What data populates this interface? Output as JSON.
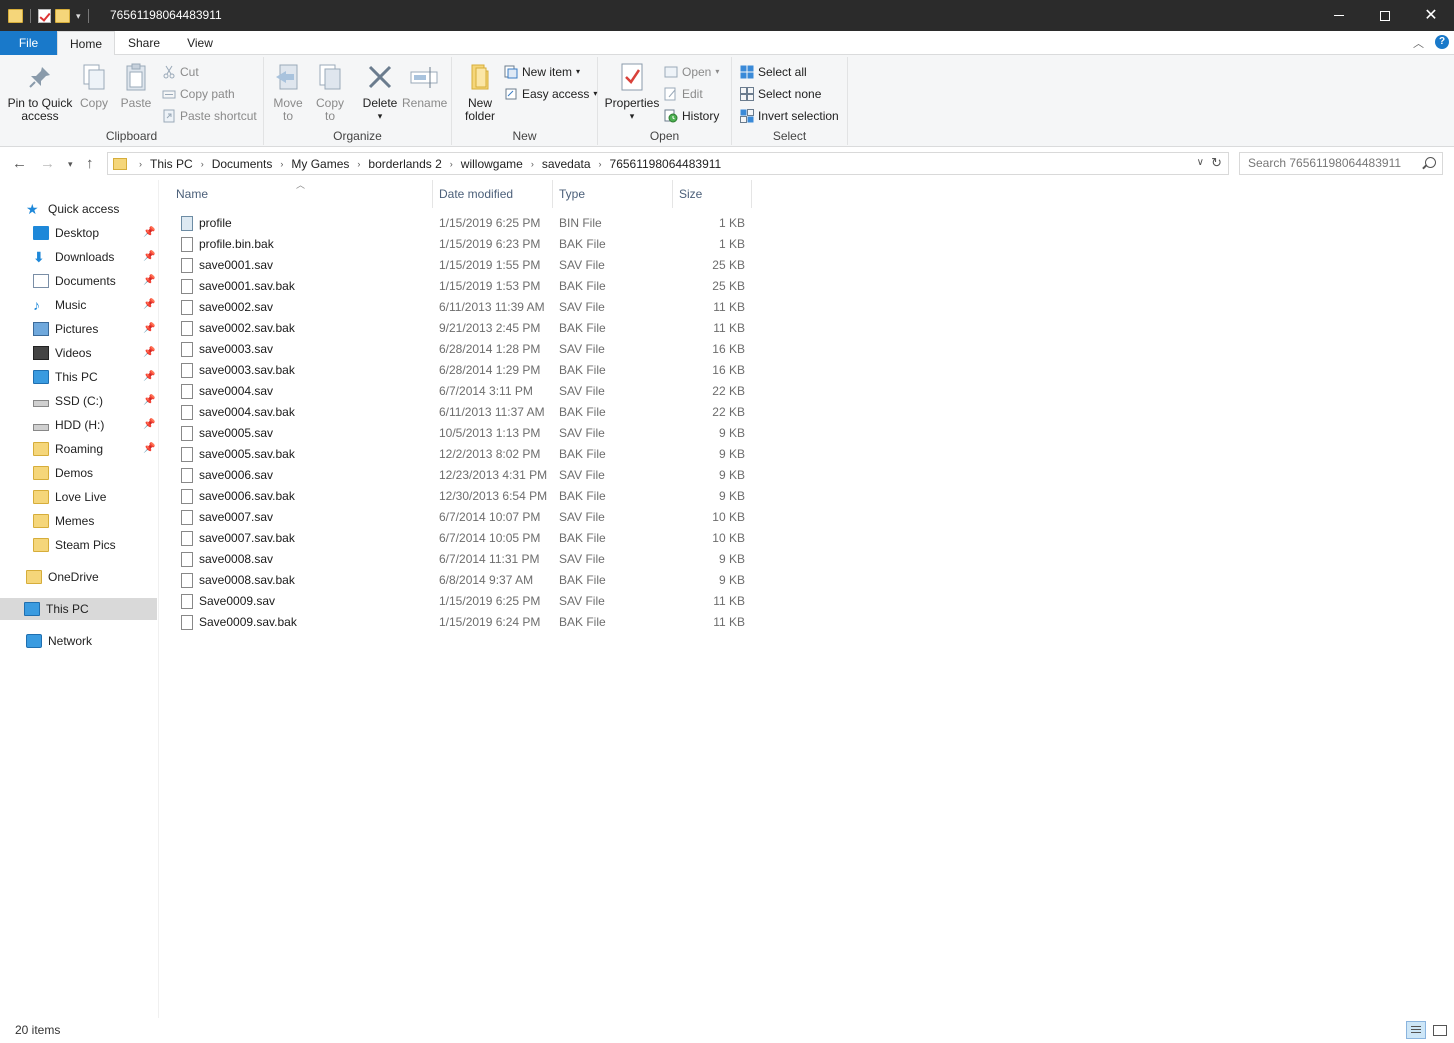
{
  "window": {
    "title": "76561198064483911"
  },
  "ribbon_tabs": [
    "File",
    "Home",
    "Share",
    "View"
  ],
  "ribbon": {
    "clipboard": {
      "label": "Clipboard",
      "pin_line1": "Pin to Quick",
      "pin_line2": "access",
      "copy": "Copy",
      "paste": "Paste",
      "cut": "Cut",
      "copy_path": "Copy path",
      "paste_shortcut": "Paste shortcut"
    },
    "organize": {
      "label": "Organize",
      "move_line1": "Move",
      "move_line2": "to",
      "copy_line1": "Copy",
      "copy_line2": "to",
      "delete": "Delete",
      "rename": "Rename"
    },
    "new": {
      "label": "New",
      "new_folder_line1": "New",
      "new_folder_line2": "folder",
      "new_item": "New item",
      "easy_access": "Easy access"
    },
    "open": {
      "label": "Open",
      "properties": "Properties",
      "open": "Open",
      "edit": "Edit",
      "history": "History"
    },
    "select": {
      "label": "Select",
      "select_all": "Select all",
      "select_none": "Select none",
      "invert_selection": "Invert selection"
    }
  },
  "address": {
    "crumbs": [
      "This PC",
      "Documents",
      "My Games",
      "borderlands 2",
      "willowgame",
      "savedata",
      "76561198064483911"
    ],
    "search_placeholder": "Search 76561198064483911"
  },
  "nav": {
    "quick_access": "Quick access",
    "pinned": [
      "Desktop",
      "Downloads",
      "Documents",
      "Music",
      "Pictures",
      "Videos",
      "This PC",
      "SSD (C:)",
      "HDD (H:)",
      "Roaming"
    ],
    "folders": [
      "Demos",
      "Love Live",
      "Memes",
      "Steam Pics"
    ],
    "onedrive": "OneDrive",
    "this_pc": "This PC",
    "network": "Network"
  },
  "columns": {
    "name": "Name",
    "date": "Date modified",
    "type": "Type",
    "size": "Size"
  },
  "files": [
    {
      "name": "profile",
      "date": "1/15/2019 6:25 PM",
      "type": "BIN File",
      "size": "1 KB"
    },
    {
      "name": "profile.bin.bak",
      "date": "1/15/2019 6:23 PM",
      "type": "BAK File",
      "size": "1 KB"
    },
    {
      "name": "save0001.sav",
      "date": "1/15/2019 1:55 PM",
      "type": "SAV File",
      "size": "25 KB"
    },
    {
      "name": "save0001.sav.bak",
      "date": "1/15/2019 1:53 PM",
      "type": "BAK File",
      "size": "25 KB"
    },
    {
      "name": "save0002.sav",
      "date": "6/11/2013 11:39 AM",
      "type": "SAV File",
      "size": "11 KB"
    },
    {
      "name": "save0002.sav.bak",
      "date": "9/21/2013 2:45 PM",
      "type": "BAK File",
      "size": "11 KB"
    },
    {
      "name": "save0003.sav",
      "date": "6/28/2014 1:28 PM",
      "type": "SAV File",
      "size": "16 KB"
    },
    {
      "name": "save0003.sav.bak",
      "date": "6/28/2014 1:29 PM",
      "type": "BAK File",
      "size": "16 KB"
    },
    {
      "name": "save0004.sav",
      "date": "6/7/2014 3:11 PM",
      "type": "SAV File",
      "size": "22 KB"
    },
    {
      "name": "save0004.sav.bak",
      "date": "6/11/2013 11:37 AM",
      "type": "BAK File",
      "size": "22 KB"
    },
    {
      "name": "save0005.sav",
      "date": "10/5/2013 1:13 PM",
      "type": "SAV File",
      "size": "9 KB"
    },
    {
      "name": "save0005.sav.bak",
      "date": "12/2/2013 8:02 PM",
      "type": "BAK File",
      "size": "9 KB"
    },
    {
      "name": "save0006.sav",
      "date": "12/23/2013 4:31 PM",
      "type": "SAV File",
      "size": "9 KB"
    },
    {
      "name": "save0006.sav.bak",
      "date": "12/30/2013 6:54 PM",
      "type": "BAK File",
      "size": "9 KB"
    },
    {
      "name": "save0007.sav",
      "date": "6/7/2014 10:07 PM",
      "type": "SAV File",
      "size": "10 KB"
    },
    {
      "name": "save0007.sav.bak",
      "date": "6/7/2014 10:05 PM",
      "type": "BAK File",
      "size": "10 KB"
    },
    {
      "name": "save0008.sav",
      "date": "6/7/2014 11:31 PM",
      "type": "SAV File",
      "size": "9 KB"
    },
    {
      "name": "save0008.sav.bak",
      "date": "6/8/2014 9:37 AM",
      "type": "BAK File",
      "size": "9 KB"
    },
    {
      "name": "Save0009.sav",
      "date": "1/15/2019 6:25 PM",
      "type": "SAV File",
      "size": "11 KB"
    },
    {
      "name": "Save0009.sav.bak",
      "date": "1/15/2019 6:24 PM",
      "type": "BAK File",
      "size": "11 KB"
    }
  ],
  "status": {
    "item_count": "20 items"
  },
  "colors": {
    "accent": "#1979ca",
    "titlebar": "#2b2b2b",
    "ribbon_bg": "#f5f6f7",
    "column_header": "#4c607a"
  }
}
